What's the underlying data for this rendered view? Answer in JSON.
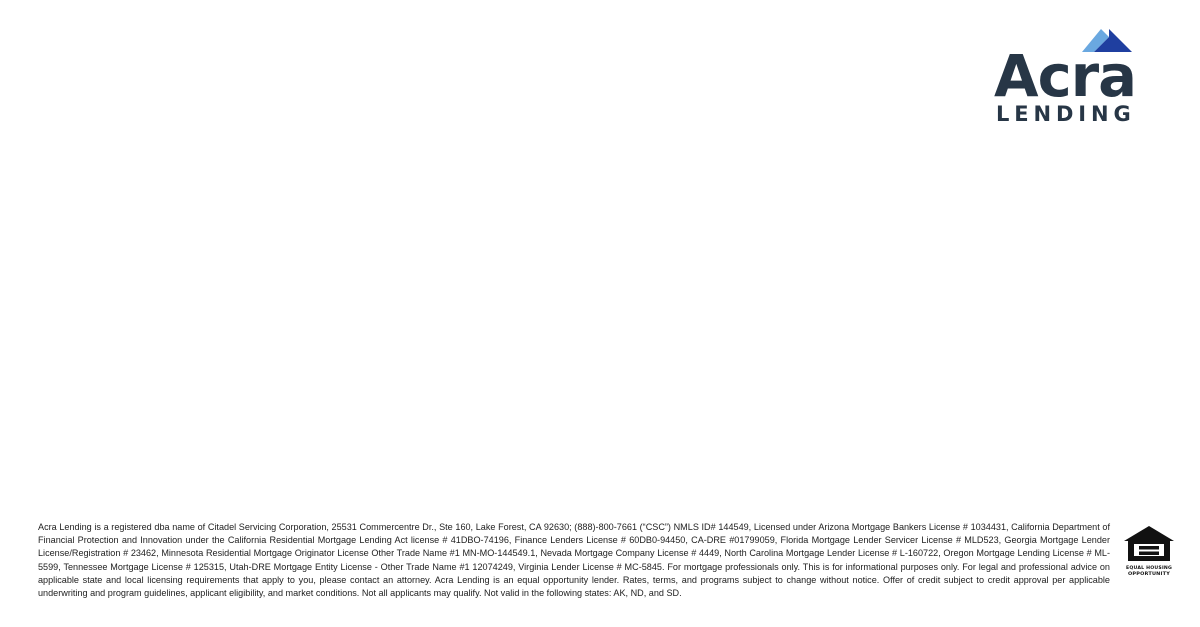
{
  "brand": {
    "name_top": "Acra",
    "name_bottom": "LENDING",
    "text_color": "#273646",
    "accent_dark": "#1f3fa0",
    "accent_light": "#6aa8e0"
  },
  "disclaimer": {
    "text": "Acra Lending is a registered dba name of Citadel Servicing Corporation, 25531 Commercentre Dr., Ste 160, Lake Forest, CA 92630; (888)-800-7661 (“CSC”) NMLS ID# 144549, Licensed under Arizona Mortgage Bankers License # 1034431, California Department of Financial Protection and Innovation under the California Residential Mortgage Lending Act license # 41DBO-74196, Finance Lenders License # 60DB0-94450, CA-DRE #01799059, Florida Mortgage Lender Servicer License # MLD523, Georgia Mortgage Lender License/Registration # 23462, Minnesota Residential Mortgage Originator License Other Trade Name #1 MN-MO-144549.1, Nevada Mortgage Company License # 4449, North Carolina Mortgage Lender License # L-160722, Oregon Mortgage Lending License # ML-5599, Tennessee Mortgage License # 125315, Utah-DRE Mortgage Entity License - Other Trade Name #1 12074249, Virginia Lender License # MC-5845. For mortgage professionals only. This is for informational purposes only. For legal and professional advice on applicable state and local licensing requirements that apply to you, please contact an attorney. Acra Lending is an equal opportunity lender. Rates, terms, and programs subject to change without notice. Offer of credit subject to credit approval per applicable underwriting and program guidelines, applicant eligibility, and market conditions. Not all applicants may qualify. Not valid in the following states: AK, ND, and SD."
  },
  "equal_housing": {
    "line1": "EQUAL HOUSING",
    "line2": "OPPORTUNITY",
    "icon": "equal-housing-opportunity-icon",
    "color": "#111111"
  }
}
